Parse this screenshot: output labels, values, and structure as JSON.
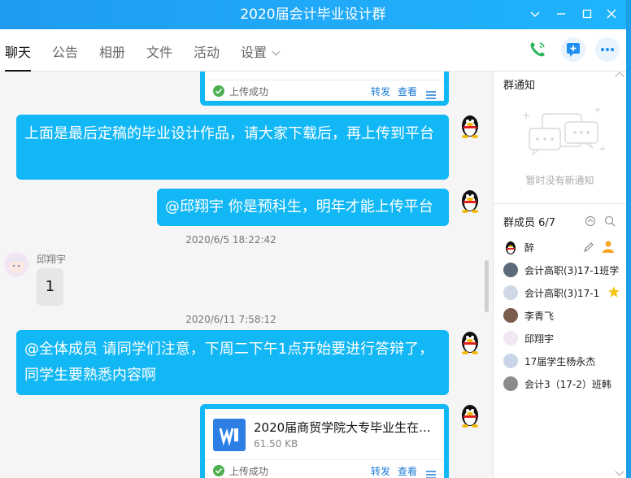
{
  "window": {
    "title": "2020届会计毕业设计群"
  },
  "tabs": [
    {
      "label": "聊天"
    },
    {
      "label": "公告"
    },
    {
      "label": "相册"
    },
    {
      "label": "文件"
    },
    {
      "label": "活动"
    },
    {
      "label": "设置"
    }
  ],
  "colors": {
    "accent": "#12b7f5",
    "title_bar": "#20a9f8",
    "link": "#1a7ad8",
    "success": "#4caf50"
  },
  "messages": {
    "top_card": {
      "status": "上传成功",
      "forward": "转发",
      "view": "查看"
    },
    "msg1": "上面是最后定稿的毕业设计作品，请大家下载后，再上传到平台",
    "msg2": "@邱翔宇 你是预科生，明年才能上传平台",
    "time1": "2020/6/5 18:22:42",
    "peer_name": "邱翔宇",
    "peer_msg": "1",
    "time2": "2020/6/11 7:58:12",
    "msg3": "@全体成员 请同学们注意，下周二下午1点开始要进行答辩了，同学生要熟悉内容啊",
    "file_card": {
      "name": "2020届商贸学院大专毕业生在...",
      "size": "61.50 KB",
      "status": "上传成功",
      "forward": "转发",
      "view": "查看"
    }
  },
  "panel": {
    "notice_title": "群通知",
    "notice_empty": "暂时没有新通知",
    "members_title": "群成员 6/7",
    "members": [
      {
        "name": "醉"
      },
      {
        "name": "会计高职(3)17-1班学"
      },
      {
        "name": "会计高职(3)17-1"
      },
      {
        "name": "李青飞"
      },
      {
        "name": "邱翔宇"
      },
      {
        "name": "17届学生杨永杰"
      },
      {
        "name": "会计3（17-2）班韩"
      }
    ]
  }
}
